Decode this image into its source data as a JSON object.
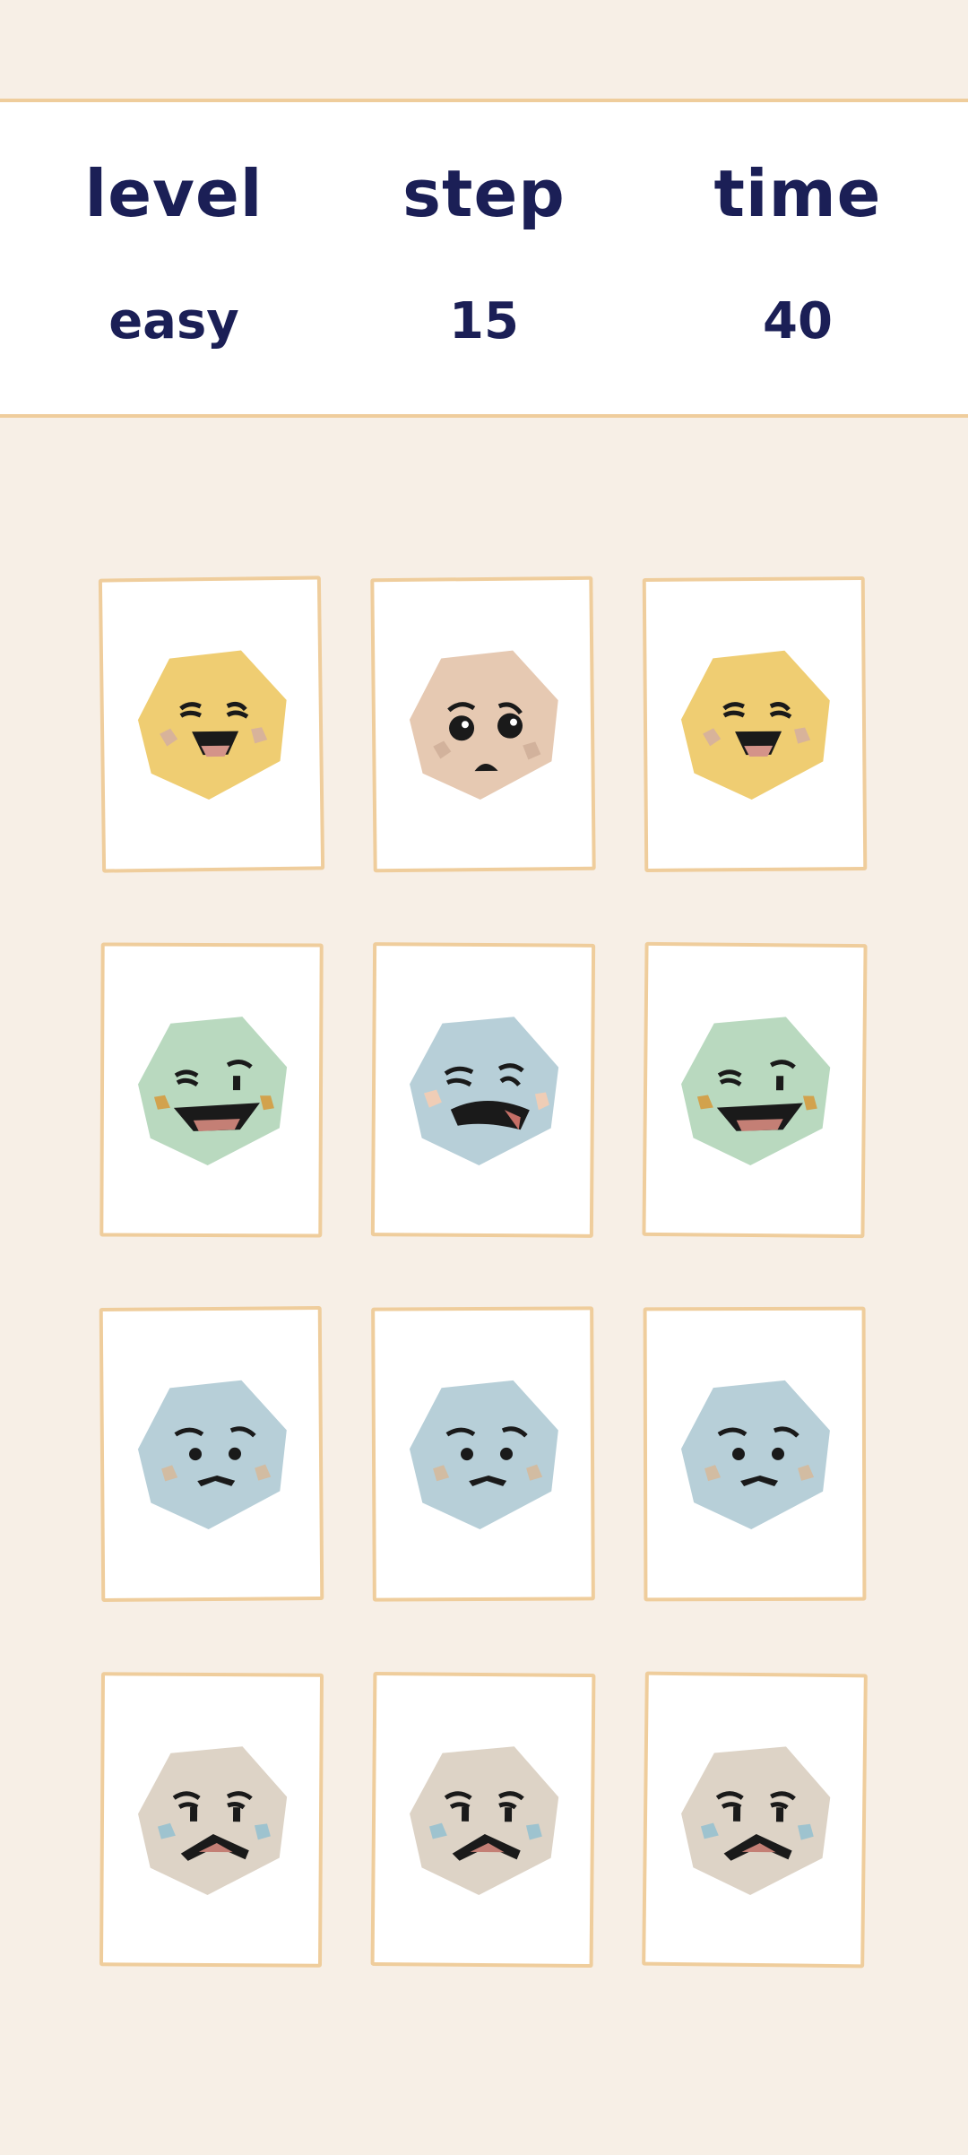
{
  "header": {
    "level_label": "level",
    "level_value": "easy",
    "step_label": "step",
    "step_value": "15",
    "time_label": "time",
    "time_value": "40"
  },
  "colors": {
    "background": "#f7efe6",
    "border": "#efcd9c",
    "text": "#1b1f56"
  },
  "cards": [
    {
      "face": "laughing-face-icon",
      "color": "#efcd72"
    },
    {
      "face": "worried-face-icon",
      "color": "#e6c9b2"
    },
    {
      "face": "laughing-face-icon",
      "color": "#efcd72"
    },
    {
      "face": "winking-grin-face-icon",
      "color": "#b9d9bf"
    },
    {
      "face": "tongue-face-icon",
      "color": "#b7cfd8"
    },
    {
      "face": "winking-grin-face-icon",
      "color": "#b9d9bf"
    },
    {
      "face": "sad-face-icon",
      "color": "#b7cfd8"
    },
    {
      "face": "sad-face-icon",
      "color": "#b7cfd8"
    },
    {
      "face": "sad-face-icon",
      "color": "#b7cfd8"
    },
    {
      "face": "grumpy-face-icon",
      "color": "#ddd3c6"
    },
    {
      "face": "grumpy-face-icon",
      "color": "#ddd3c6"
    },
    {
      "face": "grumpy-face-icon",
      "color": "#ddd3c6"
    }
  ]
}
